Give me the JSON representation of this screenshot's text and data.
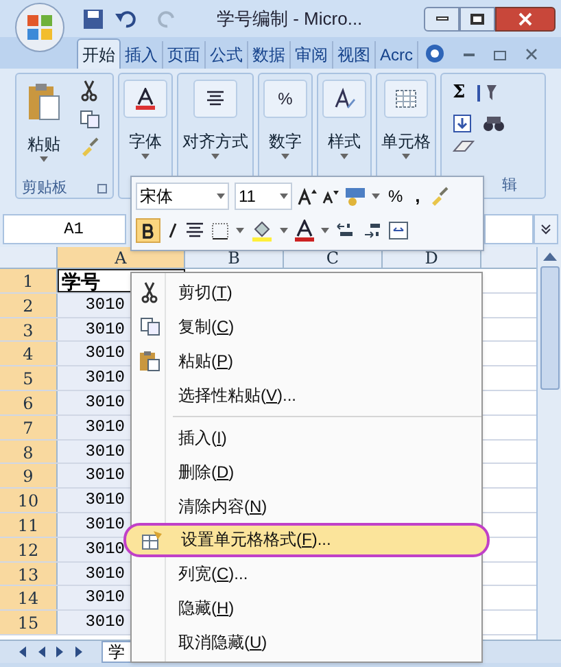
{
  "window": {
    "title": "学号编制 - Micro..."
  },
  "tabs": [
    {
      "label": "开始",
      "selected": true
    },
    {
      "label": "插入",
      "selected": false
    },
    {
      "label": "页面",
      "selected": false
    },
    {
      "label": "公式",
      "selected": false
    },
    {
      "label": "数据",
      "selected": false
    },
    {
      "label": "审阅",
      "selected": false
    },
    {
      "label": "视图",
      "selected": false
    },
    {
      "label": "Acrc",
      "selected": false
    }
  ],
  "ribbon": {
    "clipboard": {
      "label": "粘贴",
      "footer": "剪贴板"
    },
    "groups": [
      {
        "kind": "font",
        "label": "字体"
      },
      {
        "kind": "align",
        "label": "对齐方式"
      },
      {
        "kind": "number",
        "label": "数字",
        "symbol": "%"
      },
      {
        "kind": "style",
        "label": "样式"
      },
      {
        "kind": "cells",
        "label": "单元格"
      }
    ],
    "editing": {
      "sum": "Σ",
      "footer": "辑"
    }
  },
  "mini_toolbar": {
    "font": "宋体",
    "size": "11",
    "percent": "%",
    "comma": ","
  },
  "name_box": "A1",
  "columns": [
    "A",
    "B",
    "C",
    "D"
  ],
  "rows": [
    {
      "header": "1",
      "cell": "学号"
    },
    {
      "header": "2",
      "cell": "3010"
    },
    {
      "header": "3",
      "cell": "3010"
    },
    {
      "header": "4",
      "cell": "3010"
    },
    {
      "header": "5",
      "cell": "3010"
    },
    {
      "header": "6",
      "cell": "3010"
    },
    {
      "header": "7",
      "cell": "3010"
    },
    {
      "header": "8",
      "cell": "3010"
    },
    {
      "header": "9",
      "cell": "3010"
    },
    {
      "header": "10",
      "cell": "3010"
    },
    {
      "header": "11",
      "cell": "3010"
    },
    {
      "header": "12",
      "cell": "3010"
    },
    {
      "header": "13",
      "cell": "3010"
    },
    {
      "header": "14",
      "cell": "3010"
    },
    {
      "header": "15",
      "cell": "3010"
    }
  ],
  "sheet_tab": "学",
  "context_menu": [
    {
      "kind": "cut",
      "label": "剪切(T)",
      "highlighted": false
    },
    {
      "kind": "copy",
      "label": "复制(C)",
      "highlighted": false
    },
    {
      "kind": "paste",
      "label": "粘贴(P)",
      "highlighted": false
    },
    {
      "kind": "plain",
      "label": "选择性粘贴(V)...",
      "highlighted": false
    },
    {
      "kind": "separator"
    },
    {
      "kind": "plain",
      "label": "插入(I)",
      "highlighted": false
    },
    {
      "kind": "plain",
      "label": "删除(D)",
      "highlighted": false
    },
    {
      "kind": "plain",
      "label": "清除内容(N)",
      "highlighted": false
    },
    {
      "kind": "format",
      "label": "设置单元格格式(F)...",
      "highlighted": true
    },
    {
      "kind": "plain",
      "label": "列宽(C)...",
      "highlighted": false
    },
    {
      "kind": "plain",
      "label": "隐藏(H)",
      "highlighted": false
    },
    {
      "kind": "plain",
      "label": "取消隐藏(U)",
      "highlighted": false
    }
  ]
}
